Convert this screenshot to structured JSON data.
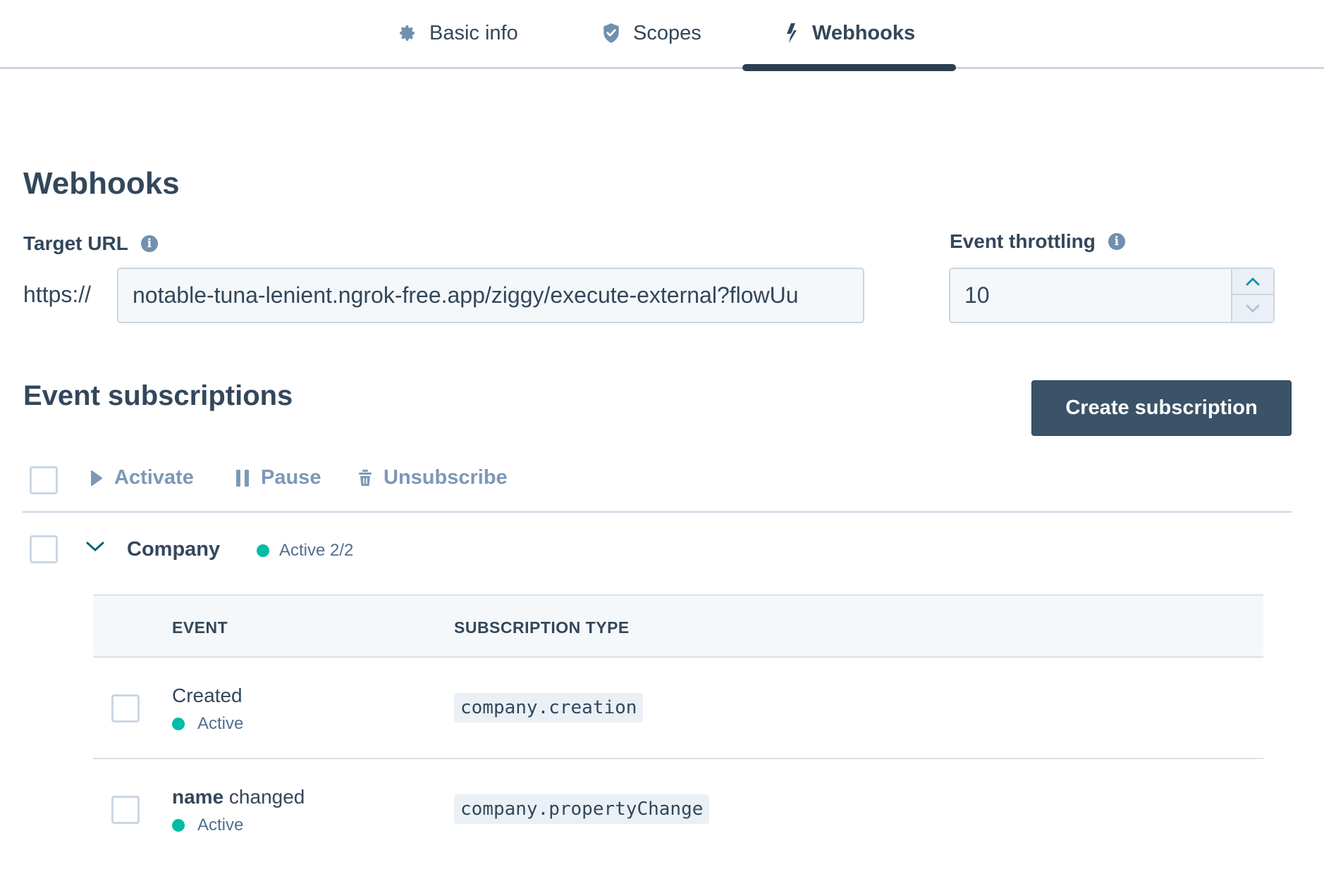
{
  "tabs": [
    {
      "label": "Basic info",
      "icon": "gear-icon",
      "active": false
    },
    {
      "label": "Scopes",
      "icon": "shield-check-icon",
      "active": false
    },
    {
      "label": "Webhooks",
      "icon": "lightning-icon",
      "active": true
    }
  ],
  "page": {
    "title": "Webhooks"
  },
  "target_url": {
    "label": "Target URL",
    "prefix": "https://",
    "value": "notable-tuna-lenient.ngrok-free.app/ziggy/execute-external?flowUu"
  },
  "throttling": {
    "label": "Event throttling",
    "value": "10"
  },
  "subscriptions": {
    "title": "Event subscriptions",
    "create_label": "Create subscription",
    "bulk_actions": {
      "activate": "Activate",
      "pause": "Pause",
      "unsubscribe": "Unsubscribe"
    },
    "group": {
      "name": "Company",
      "status": "Active 2/2",
      "expanded": true
    },
    "table": {
      "columns": [
        "EVENT",
        "SUBSCRIPTION TYPE"
      ],
      "rows": [
        {
          "event_bold": "",
          "event_text": "Created",
          "status": "Active",
          "type": "company.creation"
        },
        {
          "event_bold": "name",
          "event_text": " changed",
          "status": "Active",
          "type": "company.propertyChange"
        }
      ]
    }
  },
  "colors": {
    "primary_button": "#3b5369",
    "active_dot": "#00bda5",
    "tab_indicator": "#2d3e50",
    "muted_action": "#7c98b6"
  }
}
